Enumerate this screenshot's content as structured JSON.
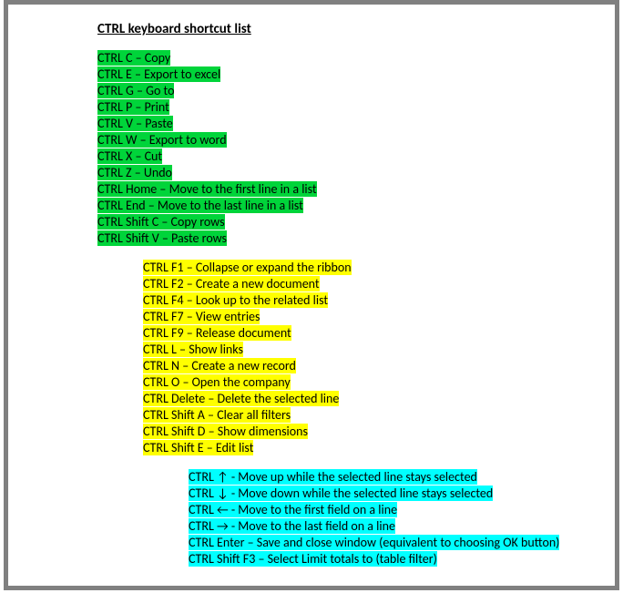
{
  "title": "CTRL keyboard shortcut list",
  "groups": [
    {
      "indent": "g1",
      "highlight": "hl-green",
      "items": [
        "CTRL C – Copy",
        "CTRL E – Export to excel",
        "CTRL G – Go to",
        "CTRL P – Print",
        "CTRL V – Paste",
        "CTRL W – Export to word",
        "CTRL X – Cut",
        "CTRL Z – Undo",
        "CTRL Home – Move to the first line in a list",
        "CTRL End – Move to the last line in a list",
        "CTRL Shift C – Copy rows",
        "CTRL Shift V – Paste rows"
      ]
    },
    {
      "indent": "g2",
      "highlight": "hl-yellow",
      "items": [
        "CTRL F1 – Collapse or expand the ribbon",
        "CTRL F2 – Create a new document",
        "CTRL F4 – Look up to the related list",
        "CTRL F7 – View entries",
        "CTRL F9 – Release document",
        "CTRL L – Show links",
        "CTRL N – Create a new record",
        "CTRL O – Open the company",
        "CTRL Delete – Delete the selected line",
        "CTRL Shift A – Clear all filters",
        "CTRL Shift D – Show dimensions",
        "CTRL Shift E – Edit list"
      ]
    },
    {
      "indent": "g3",
      "highlight": "hl-cyan",
      "items": [
        "CTRL ↑ - Move up while the selected line stays selected",
        "CTRL ↓ - Move down while the selected line stays selected",
        "CTRL ← - Move to the first field on a line",
        "CTRL → - Move to the last field on a line",
        "CTRL Enter – Save and close window (equivalent to choosing OK button)",
        "CTRL Shift F3 – Select Limit totals to (table filter)"
      ]
    }
  ]
}
